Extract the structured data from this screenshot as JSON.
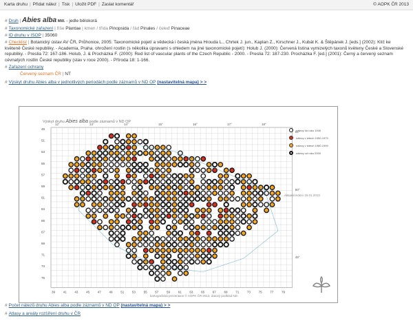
{
  "nav": {
    "items": [
      "Karta druhu",
      "Přidat nález",
      "Tisk",
      "Uložit PDF",
      "Zaslat komentář"
    ],
    "copyright": "© AOPK ČR 2013"
  },
  "druh": {
    "label": "Druh",
    "name": "Abies alba",
    "author": "Mill.",
    "common": "- jedle bělokorá"
  },
  "taxonomy": {
    "label": "Taxonomické zařazení",
    "parts": [
      {
        "rank": "říše",
        "value": "Plantae"
      },
      {
        "rank": "kmen",
        "value": ""
      },
      {
        "rank": "třída",
        "value": "Pinopsida"
      },
      {
        "rank": "řád",
        "value": "Pinales"
      },
      {
        "rank": "čeleď",
        "value": "Pinaceae"
      }
    ]
  },
  "isop": {
    "label": "ID druhu v ISOP",
    "value": "35060"
  },
  "checklist": {
    "label": "Checklist",
    "text": "Botanický ústav AV ČR, Průhonice, 2005: Taxonomické pojetí a vědecká i česká jména Hrouda L., Chrtek J. jun., Kaplan Z., Kirschner J., Kubát K. & Štěpánek J. [eds.] (2002): Klíč ke květeně České republiky. - Academia, Praha. ohrožení rostlin (s několika úpravami s ohledem na jiné taxonomické pojetí): Holub J. (2000): Červená listina vymizelých taxonů květeny České a Slovenské republiky. - Preslia 72: 167-186. Holub, J. & Procházka F. (2000): Red list of vascular plants of the Czech Republic - 2000. - Preslia 72: 187-230. Procházka F. [ed.] (2001): Černý a červený seznam cévnatých rostlin České republiky (stav v roce 2000). - Příroda 18: 1-166."
  },
  "ochrana": {
    "label": "Zařazení ochrany",
    "list": "Červený seznam ČR",
    "value": "NT"
  },
  "vyskyt": {
    "label": "Výskyt druhu Abies alba v jednotlivých periodách podle záznamů v ND OP",
    "link": "(nastavitelná mapa) > >"
  },
  "map": {
    "title_prefix": "Výskyt druhu",
    "title_species": "Abies alba",
    "title_suffix": "podle záznamů v ND OP",
    "lon_labels": [
      "12°",
      "13°",
      "14°",
      "15°",
      "16°",
      "17°",
      "18°"
    ],
    "lat_labels": [
      "51°",
      "50°",
      "49°"
    ],
    "row_labels": [
      "49",
      "51",
      "53",
      "55",
      "57",
      "59",
      "61",
      "63",
      "65",
      "67",
      "69",
      "71",
      "73",
      "75"
    ],
    "col_labels": [
      "39",
      "41",
      "43",
      "45",
      "47",
      "49",
      "51",
      "53",
      "55",
      "57",
      "59",
      "61",
      "63",
      "65",
      "67",
      "69",
      "71",
      "73",
      "75",
      "77",
      "79"
    ],
    "legend": [
      {
        "label": "nálezy do roku 1949",
        "fill": "#ffffff"
      },
      {
        "label": "nálezy v letech 1950-1979",
        "fill": "#d9301e"
      },
      {
        "label": "nálezy v letech 1980-1999",
        "fill": "#f5a623"
      },
      {
        "label": "nálezy od roku 2000",
        "fill": "#ffffff"
      }
    ],
    "date": "Aktualizováno 15.01.2013",
    "footer": "kartografická prezentace © AOPK ČR 2013, datový podklad ND",
    "colors": {
      "grid": "#cfcfcf",
      "border": "#2a8fa8",
      "orange": "#f5a623",
      "red": "#d9301e"
    }
  },
  "bottom": [
    {
      "text": "Počet nálezů druhu Abies alba podle záznamů v ND OP",
      "link": "(nastavitelná mapa) > >"
    },
    {
      "text": "Atlasy a areály rozšíření druhu v ČR",
      "link": ""
    }
  ]
}
